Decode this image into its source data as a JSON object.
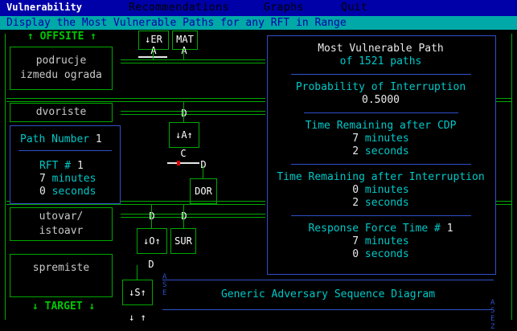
{
  "menu": {
    "items": [
      "Vulnerability",
      "Recommendations",
      "Graphs",
      "Quit"
    ]
  },
  "status_line": "Display the Most Vulnerable Paths for any RFT in Range",
  "diagram": {
    "offsite_label": "↑ OFFSITE ↑",
    "target_label": "↓ TARGET ↓",
    "areas": [
      {
        "line1": "podrucje",
        "line2": "izmedu ograda"
      },
      {
        "line1": "dvoriste",
        "line2": ""
      },
      {
        "line1": "utovar/",
        "line2": "istoavr"
      },
      {
        "line1": "spremiste",
        "line2": ""
      }
    ],
    "elements": {
      "er": "↓ER",
      "mat": "MAT",
      "a1": "A",
      "a2": "A",
      "d1": "D",
      "at": "↓A↑",
      "c": "C",
      "d2": "D",
      "dor": "DOR",
      "d3": "D",
      "d4": "D",
      "ot": "↓O↑",
      "sur": "SUR",
      "d5": "D",
      "st": "↓S↑",
      "bottom_arrows": "↓ ↑"
    },
    "generic_label": "Generic Adversary Sequence Diagram",
    "left_letters": "ASE",
    "right_letters": "ASEZ"
  },
  "path_panel": {
    "title": "Path Number",
    "number": "1",
    "rft_label": "RFT #",
    "rft_number": "1",
    "minutes_value": "7",
    "minutes_unit": "minutes",
    "seconds_value": "0",
    "seconds_unit": "seconds"
  },
  "results": {
    "title": "Most Vulnerable Path",
    "of_label": "of 1521 paths",
    "prob_label": "Probability of Interruption",
    "prob_value": "0.5000",
    "cdp_label": "Time Remaining after CDP",
    "cdp_min_value": "7",
    "cdp_min_unit": "minutes",
    "cdp_sec_value": "2",
    "cdp_sec_unit": "seconds",
    "int_label": "Time Remaining after Interruption",
    "int_min_value": "0",
    "int_min_unit": "minutes",
    "int_sec_value": "2",
    "int_sec_unit": "seconds",
    "rft_label": "Response Force Time #",
    "rft_number": "1",
    "rft_min_value": "7",
    "rft_min_unit": "minutes",
    "rft_sec_value": "0",
    "rft_sec_unit": "seconds"
  }
}
